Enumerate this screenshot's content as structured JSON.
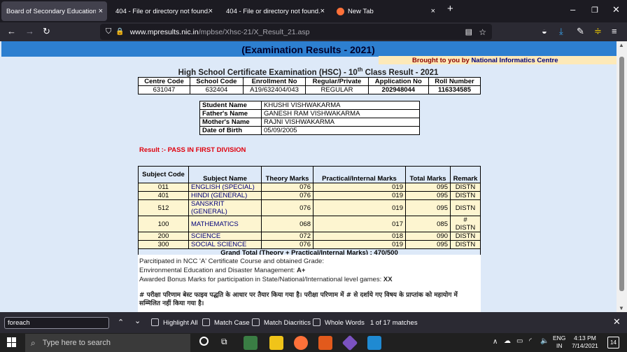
{
  "tabs": [
    {
      "title": "Board of Secondary Education, Mad",
      "active": true
    },
    {
      "title": "404 - File or directory not found.",
      "active": false
    },
    {
      "title": "404 - File or directory not found.",
      "active": false
    },
    {
      "title": "New Tab",
      "active": false
    }
  ],
  "url": {
    "domain": "www.mpresults.nic.in",
    "path": "/mpbse/Xhsc-21/X_Result_21.asp"
  },
  "page": {
    "exam_title": "(Examination Results - 2021)",
    "brought_prefix": "Brought to you by ",
    "brought_org": "National Informatics Centre",
    "hsc_title": "High School Certificate Examination (HSC) - 10",
    "hsc_sup": "th",
    "hsc_suffix": " Class Result - 2021",
    "header_cols": [
      "Centre Code",
      "School Code",
      "Enrollment No",
      "Regular/Private",
      "Application No",
      "Roll Number"
    ],
    "header_vals": [
      "631047",
      "632404",
      "A19/632404/043",
      "REGULAR",
      "202948044",
      "116334585"
    ],
    "student": [
      {
        "label": "Student Name",
        "value": "KHUSHI VISHWAKARMA"
      },
      {
        "label": "Father's Name",
        "value": "GANESH RAM VISHWAKARMA"
      },
      {
        "label": "Mother's Name",
        "value": "RAJNI VISHWAKARMA"
      },
      {
        "label": "Date of Birth",
        "value": "05/09/2005"
      }
    ],
    "result": "Result :- PASS IN FIRST DIVISION",
    "marks_cols": [
      "Subject Code",
      "Subject Name",
      "Theory Marks",
      "Practical/Internal Marks",
      "Total Marks",
      "Remark"
    ],
    "marks_rows": [
      [
        "011",
        "ENGLISH (SPECIAL)",
        "076",
        "019",
        "095",
        "DISTN"
      ],
      [
        "401",
        "HINDI (GENERAL)",
        "076",
        "019",
        "095",
        "DISTN"
      ],
      [
        "512",
        "SANSKRIT (GENERAL)",
        "076",
        "019",
        "095",
        "DISTN"
      ],
      [
        "100",
        "MATHEMATICS",
        "068",
        "017",
        "085",
        "# DISTN"
      ],
      [
        "200",
        "SCIENCE",
        "072",
        "018",
        "090",
        "DISTN"
      ],
      [
        "300",
        "SOCIAL SCIENCE",
        "076",
        "019",
        "095",
        "DISTN"
      ]
    ],
    "grand_total": "Grand Total (Theory + Practical/Internal Marks) : 470/500",
    "notes": {
      "ncc": "Parcitipated in NCC 'A' Certificate Course and obtained Grade:",
      "env_label": "Environmental Education and Disaster Management: ",
      "env_value": "A+",
      "bonus_label": "Awarded Bonus Marks for participation in State/National/International level games: ",
      "bonus_value": "XX",
      "hindi": "# परीक्षा परिणाम बेस्ट फाइव पद्धति के आधार पर तैयार किया गया है। परीक्षा परिणाम में # से दर्शाये गए विषय के प्राप्तांक को महायोग में सम्मिलित नहीं किया गया है।"
    }
  },
  "findbar": {
    "query": "foreach",
    "options": [
      "Highlight All",
      "Match Case",
      "Match Diacritics",
      "Whole Words"
    ],
    "status": "1 of 17 matches"
  },
  "taskbar": {
    "search_placeholder": "Type here to search",
    "lang": "ENG",
    "region": "IN",
    "time": "4:13 PM",
    "date": "7/14/2021",
    "notif_count": "14"
  },
  "colors": {
    "band": "#2d7fd0",
    "page_bg": "#dde9f8",
    "credit_bg": "#fde9b8",
    "result_red": "#e0000c",
    "row_bg": "#fdf5d0"
  }
}
